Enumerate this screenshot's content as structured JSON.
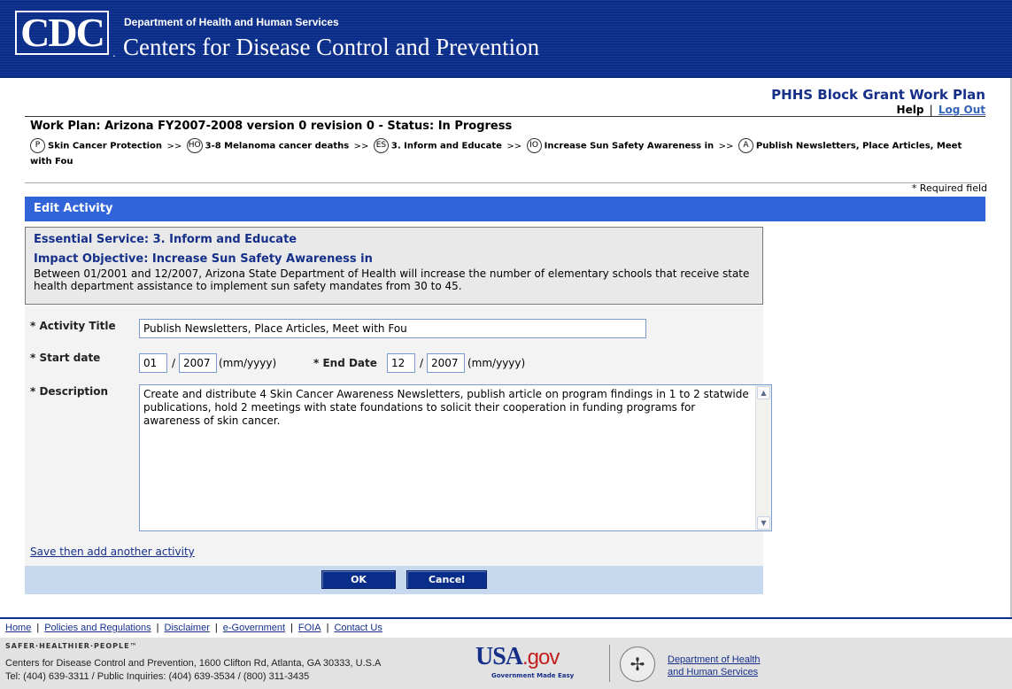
{
  "banner": {
    "logo_text": "CDC",
    "department": "Department of Health and Human Services",
    "center": "Centers for Disease Control and Prevention"
  },
  "app": {
    "title": "PHHS Block Grant Work Plan",
    "help": "Help",
    "separator": "|",
    "logout": "Log Out"
  },
  "workplan": {
    "status": "Work Plan: Arizona FY2007-2008 version 0 revision 0 - Status: In Progress",
    "breadcrumbs": [
      {
        "icon": "P",
        "label": "Skin Cancer Protection"
      },
      {
        "icon": "HO",
        "label": "3-8 Melanoma cancer deaths"
      },
      {
        "icon": "ES",
        "label": "3. Inform and Educate"
      },
      {
        "icon": "IO",
        "label": "Increase Sun Safety Awareness in"
      },
      {
        "icon": "A",
        "label": "Publish Newsletters, Place Articles, Meet with Fou"
      }
    ],
    "crumb_separator": ">>"
  },
  "required_note": "* Required field",
  "section_title": "Edit Activity",
  "context": {
    "essential_service": "Essential Service: 3. Inform and Educate",
    "impact_objective": "Impact Objective: Increase Sun Safety Awareness in",
    "impact_description": "Between 01/2001 and 12/2007, Arizona State Department of Health will increase the number of elementary schools that receive state health department assistance to implement sun safety mandates from 30 to 45."
  },
  "form": {
    "activity_title_label": "* Activity Title",
    "activity_title_value": "Publish Newsletters, Place Articles, Meet with Fou",
    "start_date_label": "* Start date",
    "start_month": "01",
    "start_year": "2007",
    "date_slash": "/",
    "date_format": "(mm/yyyy)",
    "end_date_label": "* End Date",
    "end_month": "12",
    "end_year": "2007",
    "description_label": "* Description",
    "description_value": "Create and distribute 4 Skin Cancer Awareness Newsletters, publish article on program findings in 1 to 2 statwide publications, hold 2 meetings with state foundations to solicit their cooperation in funding programs for awareness of skin cancer.",
    "save_add_link": "Save then add another activity",
    "ok_button": "OK",
    "cancel_button": "Cancel"
  },
  "footer": {
    "links": [
      "Home",
      "Policies and Regulations",
      "Disclaimer",
      "e-Government",
      "FOIA",
      "Contact Us"
    ],
    "slogan": "SAFER·HEALTHIER·PEOPLE™",
    "address_line1": "Centers for Disease Control and Prevention, 1600 Clifton Rd, Atlanta, GA 30333, U.S.A",
    "address_line2": "Tel: (404) 639-3311 / Public Inquiries: (404) 639-3534 / (800) 311-3435",
    "usagov_main": "USA",
    "usagov_dot": ".gov",
    "usagov_tagline": "Government Made Easy",
    "hhs_link_line1": "Department of Health",
    "hhs_link_line2": "and Human Services"
  },
  "colors": {
    "banner_blue": "#0b2d8a",
    "section_blue": "#3064d8",
    "title_navy": "#16308a",
    "button_bar": "#c6d9ee"
  },
  "icons": {
    "scroll_up": "chevron-up-icon",
    "scroll_down": "chevron-down-icon",
    "hhs_seal": "hhs-eagle-icon"
  }
}
